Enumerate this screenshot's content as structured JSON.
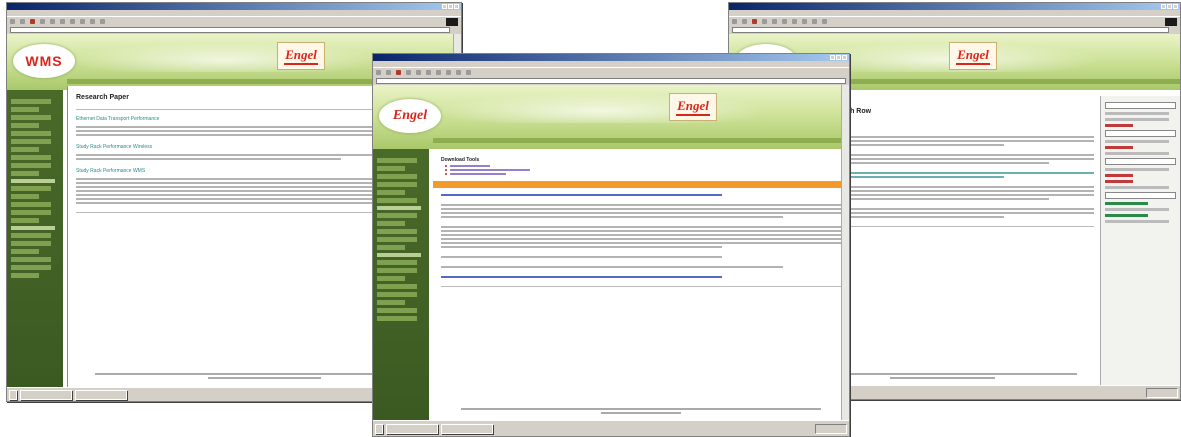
{
  "windows": {
    "left": {
      "logo": "WMS",
      "brand_logo": "Engel",
      "page_title": "Research Paper",
      "links": [
        "Ethernet Data Transport Performance",
        "Study Rack Performance Wireless",
        "Study Rack Performance WMS"
      ]
    },
    "center": {
      "brand_logo": "Engel",
      "section_heading": "Download Tools"
    },
    "right": {
      "brand_logo": "Engel",
      "page_title": "Local Dash Row",
      "section_link": "Data Data Transport"
    }
  },
  "colors": {
    "titlebar": "#0a246a",
    "banner": "#cfe39a",
    "sidebar": "#3a5a22",
    "accent_orange": "#f29a2a",
    "logo_red": "#d9261c"
  }
}
